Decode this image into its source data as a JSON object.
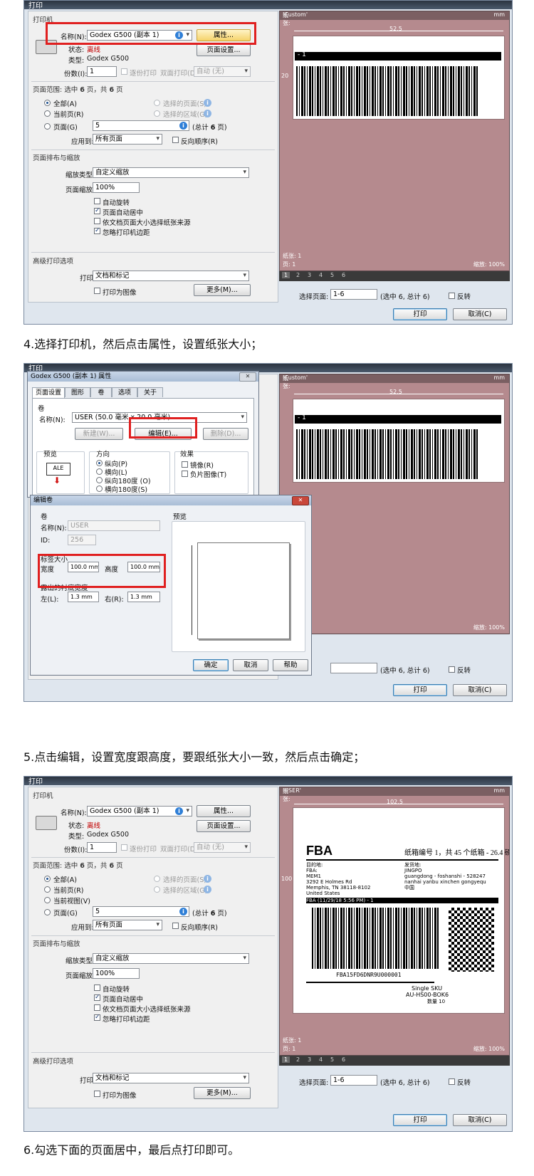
{
  "common": {
    "print_dialog_title": "打印",
    "printer_group": "打印机",
    "name_label": "名称(N):",
    "printer_name": "Godex G500 (副本 1)",
    "properties_btn": "属性...",
    "page_setup_btn": "页面设置...",
    "status_label": "状态:",
    "status_value": "离线",
    "type_label": "类型:",
    "type_value": "Godex G500",
    "copies_label": "份数(I):",
    "copies_value": "1",
    "collate_label": "逐份打印",
    "duplex_label": "双面打印(D)",
    "duplex_value": "自动 (无)",
    "page_range_title_a": "页面范围: 选中",
    "page_range_sel": "6",
    "page_range_title_b": "页，共",
    "page_range_total": "6",
    "page_range_title_c": "页",
    "all_label": "全部(A)",
    "current_label": "当前页(R)",
    "current_view_label": "当前视图(V)",
    "pages_label": "页面(G)",
    "pages_value": "5",
    "total_a": "(总计",
    "total_num": "6",
    "total_b": "页)",
    "selected_pages_label": "选择的页面(S)",
    "selected_area_label": "选择的区域(G)",
    "apply_label": "应用到:",
    "apply_value": "所有页面",
    "reverse_label": "反向顺序(R)",
    "layout_group": "页面排布与缩放",
    "scale_type_label": "缩放类型:",
    "scale_type_value": "自定义缩放",
    "page_scale_label": "页面缩放:",
    "page_scale_value": "100%",
    "auto_rotate": "自动旋转",
    "auto_center": "页面自动居中",
    "by_pdf_size": "依文档页面大小选择纸张来源",
    "ignore_margin": "忽略打印机边距",
    "advanced_group": "高级打印选项",
    "print_label": "打印",
    "print_value": "文档和标记",
    "print_as_image": "打印为图像",
    "more_btn": "更多(M)...",
    "choose_pages_label": "选择页面:",
    "choose_pages_value": "1-6",
    "choose_info": "(选中 6, 总计 6)",
    "flip_label": "反转",
    "print_btn": "打印",
    "cancel_btn": "取消(C)",
    "paper_label": "纸张:",
    "mm": "mm",
    "page_label": "页:",
    "page_num": "1",
    "scale_label": "缩放: 100%",
    "pages_nums": [
      "1",
      "2",
      "3",
      "4",
      "5",
      "6"
    ],
    "bars_label": "- 1"
  },
  "step1": {
    "paper_name": "'Custom'",
    "ruler_w": "52.5",
    "ruler_h": "20",
    "paper_count": "1",
    "caption": "4.选择打印机，然后点击属性，设置纸张大小；"
  },
  "step2": {
    "props_title": "Godex G500 (副本 1) 属性",
    "tabs": [
      "页面设置",
      "图形",
      "卷",
      "选项",
      "关于"
    ],
    "roll_group": "卷",
    "roll_name_label": "名称(N):",
    "roll_name_value": "USER (50.0 毫米 x 20.0 毫米)",
    "new_btn": "新建(W)...",
    "edit_btn": "编辑(E)...",
    "delete_btn": "删除(D)...",
    "preview_group": "预览",
    "preview_text": "ALE",
    "orient_group": "方向",
    "orient_options": [
      "纵向(P)",
      "横向(L)",
      "纵向180度 (O)",
      "横向180度(S)"
    ],
    "effect_group": "效果",
    "mirror": "镜像(R)",
    "negative": "负片图像(T)",
    "edit_title": "编辑卷",
    "edit_roll_group": "卷",
    "edit_name_label": "名称(N):",
    "edit_name_value": "USER",
    "edit_id_label": "ID:",
    "edit_id_value": "256",
    "label_size_group": "标签大小",
    "width_label": "宽度",
    "width_value": "100.0 mm",
    "height_label": "高度",
    "height_value": "100.0 mm",
    "backing_group": "露出的衬底宽度",
    "left_label": "左(L):",
    "left_value": "1.3 mm",
    "right_label": "右(R):",
    "right_value": "1.3 mm",
    "edit_preview_group": "预览",
    "ok_btn": "确定",
    "cancel_btn": "取消",
    "help_btn": "帮助",
    "caption": "5.点击编辑，设置宽度跟高度，要跟纸张大小一致，然后点击确定；"
  },
  "step3": {
    "paper_name": "'USER'",
    "ruler_w": "102.5",
    "ruler_h": "100",
    "paper_count": "1",
    "fba": "FBA",
    "fba_right": "纸箱编号 1，共 45 个纸箱 - 26.4 磅",
    "to_label": "目的地:",
    "to_lines": [
      "FBA:",
      "MEM1",
      "3292 E Holmes Rd",
      "Memphis, TN 38118-8102",
      "United States"
    ],
    "from_label": "发货地:",
    "from_lines": [
      "JINGPO",
      "guangdong - foshanshi - 528247",
      "nanhai yanbu xinchen gongyequ",
      "中国"
    ],
    "fba_small": "FBA (11/29/18 5:56 PM) - 1",
    "barcode_text": "FBA15FD6DNR9U000001",
    "single_sku": "Single SKU",
    "sku": "AU-HS00-BOK6",
    "qty": "数量 10",
    "caption": "6.勾选下面的页面居中，最后点打印即可。"
  }
}
